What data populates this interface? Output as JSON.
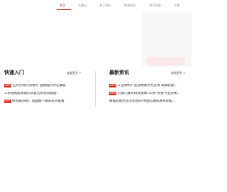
{
  "nav": {
    "items": [
      {
        "label": "首页",
        "active": true
      },
      {
        "label": "大事记",
        "active": false
      },
      {
        "label": "关于我们",
        "active": false
      },
      {
        "label": "联系我们",
        "active": false
      },
      {
        "label": "用户反馈",
        "active": false
      },
      {
        "label": "下载",
        "active": false
      }
    ],
    "active_color": "#d62c1a"
  },
  "quick_entry": {
    "title": "快速入门",
    "more": "查看更多 >",
    "items": [
      {
        "tag": "NEW",
        "text": "五月打情火热进行 盘而临内尽在掌握"
      },
      {
        "tag": "",
        "text": "三步透视超资动向从此告别低效复盘！"
      },
      {
        "tag": "HOT",
        "text": "体验再升级！电脑端一键安装开盘啦"
      }
    ]
  },
  "latest_news": {
    "title": "最新资讯",
    "more": "查看更多 >",
    "items": [
      {
        "tag": "NEW",
        "text": "工业母机产业迎政策大力支持 高端装备…"
      },
      {
        "tag": "NEW",
        "text": "七部门发布科技金融\"25条\"创投行业迎来…"
      },
      {
        "tag": "",
        "text": "数据智能生态深化协同 中国信通院发布智能…"
      }
    ]
  }
}
